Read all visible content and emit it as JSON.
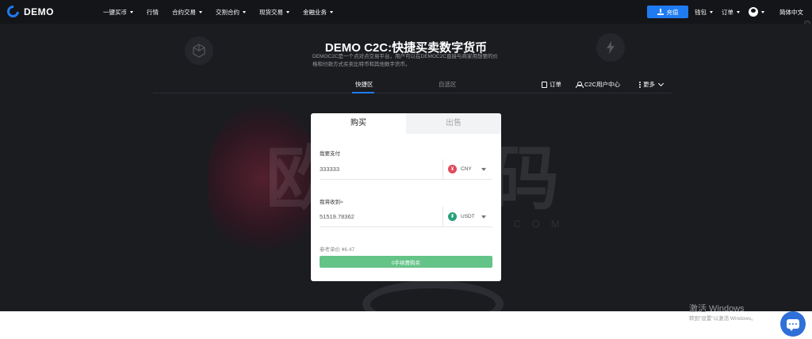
{
  "nav": {
    "logo_text": "DEMO",
    "menu": [
      {
        "label": "一键买币",
        "has_dropdown": true
      },
      {
        "label": "行情",
        "has_dropdown": false
      },
      {
        "label": "合约交易",
        "has_dropdown": true
      },
      {
        "label": "交割合约",
        "has_dropdown": true
      },
      {
        "label": "现货交易",
        "has_dropdown": true
      },
      {
        "label": "金融业务",
        "has_dropdown": true
      }
    ],
    "recharge_label": "充值",
    "wallet_label": "钱包",
    "orders_label": "订单",
    "language_label": "简体中文"
  },
  "hero": {
    "title": "DEMO C2C:快捷买卖数字货币",
    "description": "DEMOC2C是一个点对点交易平台，用户可以在DEMOC2C直接与商家用想要的价格和付款方式买卖比特币和其他数字货币。",
    "watermark": "欧鹿源码",
    "watermark_sub": "OULUYM.COM"
  },
  "tabs": {
    "quick": "快捷区",
    "self_select": "自选区",
    "orders": "订单",
    "c2c_center": "C2C用户中心",
    "more": "更多"
  },
  "trade": {
    "buy_tab": "购买",
    "sell_tab": "出售",
    "pay_label": "我要支付",
    "pay_amount": "333333",
    "pay_currency": "CNY",
    "receive_label": "我将收到≈",
    "receive_amount": "51519.78362",
    "receive_currency": "USDT",
    "reference_price": "参考单价 ¥6.47",
    "buy_button": "0手续费购买"
  },
  "windows": {
    "activate_title": "激活 Windows",
    "activate_sub": "转到\"设置\"以激活 Windows。"
  },
  "colors": {
    "accent": "#1f7bf2",
    "buy_button": "#64c387",
    "nav_bg": "#141519",
    "hero_bg": "#1b1c20"
  }
}
